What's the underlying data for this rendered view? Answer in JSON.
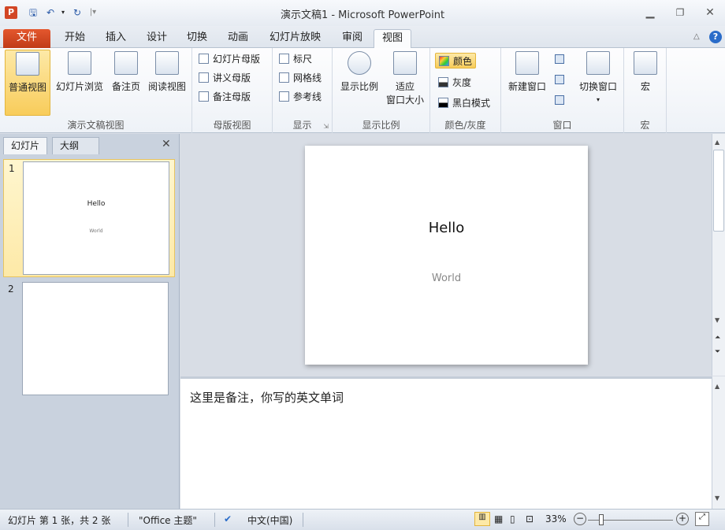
{
  "window": {
    "title": "演示文稿1 - Microsoft PowerPoint",
    "logo": "P"
  },
  "tabs": [
    "文件",
    "开始",
    "插入",
    "设计",
    "切换",
    "动画",
    "幻灯片放映",
    "审阅",
    "视图"
  ],
  "active_tab": "视图",
  "ribbon": {
    "presentation_views": {
      "label": "演示文稿视图",
      "normal": "普通视图",
      "slide_sorter": "幻灯片浏览",
      "notes_page": "备注页",
      "reading_view": "阅读视图"
    },
    "master_views": {
      "label": "母版视图",
      "slide_master": "幻灯片母版",
      "handout_master": "讲义母版",
      "notes_master": "备注母版"
    },
    "show": {
      "label": "显示",
      "ruler": "标尺",
      "gridlines": "网格线",
      "guides": "参考线"
    },
    "zoom": {
      "label": "显示比例",
      "zoom": "显示比例",
      "fit_line1": "适应",
      "fit_line2": "窗口大小"
    },
    "color": {
      "label": "颜色/灰度",
      "color": "颜色",
      "grayscale": "灰度",
      "bw": "黑白模式"
    },
    "window": {
      "label": "窗口",
      "new_window": "新建窗口",
      "switch_windows": "切换窗口"
    },
    "macros": {
      "label": "宏",
      "macros": "宏"
    }
  },
  "panel": {
    "tab_slides": "幻灯片",
    "tab_outline": "大纲",
    "close": "✕",
    "thumbnails": [
      {
        "number": "1",
        "title": "Hello",
        "subtitle": "World"
      },
      {
        "number": "2"
      }
    ]
  },
  "slide": {
    "title": "Hello",
    "subtitle": "World"
  },
  "notes": {
    "text": "这里是备注，你写的英文单词"
  },
  "status": {
    "slide_info": "幻灯片 第 1 张，共 2 张",
    "theme": "\"Office 主题\"",
    "language": "中文(中国)",
    "zoom": "33%"
  }
}
